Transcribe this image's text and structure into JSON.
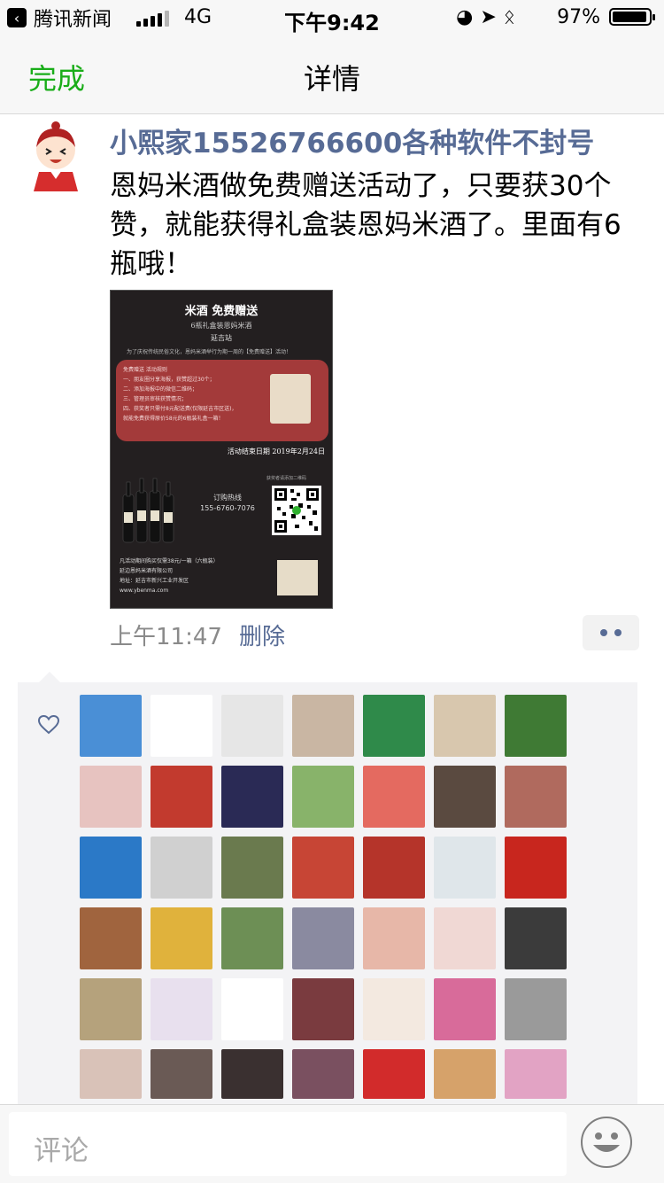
{
  "status_bar": {
    "back_app": "腾讯新闻",
    "network": "4G",
    "time": "下午9:42",
    "battery": "97%"
  },
  "nav": {
    "done": "完成",
    "title": "详情"
  },
  "post": {
    "author": "小熙家15526766600各种软件不封号",
    "text": "恩妈米酒做免费赠送活动了，只要获30个赞，就能获得礼盒装恩妈米酒了。里面有6瓶哦！",
    "time": "上午11:47",
    "delete": "删除"
  },
  "post_image": {
    "title": "米酒 免费赠送",
    "subtitle": "6瓶礼盒装恩妈米酒",
    "location": "延吉站",
    "intro": "为了庆祝传统民俗文化，恩妈米酒举行为期一周的【免费赠送】活动！",
    "rules": "免费赠送 活动规则\n一、朋友圈分享海报，获赞超过30个；\n二、添加海报中的微信二维码；\n三、管理员审核获赞情况；\n四、获奖者只需付8元配送费(仅限延吉市区送)，\n    就能免费获得原价58元的6瓶装礼盒一箱！",
    "end_date": "活动结束日期 2019年2月24日",
    "hotline_label": "订购热线",
    "hotline": "155-6760-7076",
    "qr_note": "获奖者请添加二维码",
    "footer": "凡活动期间购买仅需38元/一箱（六瓶装）\n延边恩妈米酒有限公司\n地址：延吉市新兴工业开发区\nwww.ybenma.com"
  },
  "likes": {
    "icon": "heart-outline-icon",
    "avatars": [
      {
        "name": "avatar-palm-tree",
        "color": "#4a8fd6"
      },
      {
        "name": "avatar-cartoon-girl",
        "color": "#ffffff"
      },
      {
        "name": "avatar-blank",
        "color": "#e6e6e6"
      },
      {
        "name": "avatar-child",
        "color": "#c9b6a3"
      },
      {
        "name": "avatar-pool-table",
        "color": "#2f8a4a"
      },
      {
        "name": "avatar-woman-office",
        "color": "#d8c7ae"
      },
      {
        "name": "avatar-green-wall",
        "color": "#3f7a34"
      },
      {
        "name": "avatar-two-girls",
        "color": "#e7c3c0"
      },
      {
        "name": "avatar-red-fan",
        "color": "#c23a2e"
      },
      {
        "name": "avatar-night-bridge",
        "color": "#2a2a55"
      },
      {
        "name": "avatar-baby",
        "color": "#88b36a"
      },
      {
        "name": "avatar-girl-red",
        "color": "#e46a60"
      },
      {
        "name": "avatar-couple",
        "color": "#5a4a40"
      },
      {
        "name": "avatar-selfie-pair",
        "color": "#b06a5e"
      },
      {
        "name": "avatar-fish",
        "color": "#2b79c7"
      },
      {
        "name": "avatar-bw-woman",
        "color": "#d0d0d0"
      },
      {
        "name": "avatar-mountain",
        "color": "#6a7a4e"
      },
      {
        "name": "avatar-kid-hat",
        "color": "#c74535"
      },
      {
        "name": "avatar-lion-dance",
        "color": "#b5342a"
      },
      {
        "name": "avatar-elephant",
        "color": "#dfe6ea"
      },
      {
        "name": "avatar-tata-ad",
        "color": "#c8261e"
      },
      {
        "name": "avatar-hand",
        "color": "#a0643e"
      },
      {
        "name": "avatar-poster",
        "color": "#e0b23c"
      },
      {
        "name": "avatar-bridge-man",
        "color": "#6d8f55"
      },
      {
        "name": "avatar-wedding",
        "color": "#8a8aa0"
      },
      {
        "name": "avatar-cat-filter",
        "color": "#e7b7a8"
      },
      {
        "name": "avatar-long-hair",
        "color": "#f0d8d4"
      },
      {
        "name": "avatar-dark-girl",
        "color": "#3b3b3b"
      },
      {
        "name": "avatar-sketch",
        "color": "#b5a27c"
      },
      {
        "name": "avatar-anime",
        "color": "#e8e0ee"
      },
      {
        "name": "avatar-logo",
        "color": "#ffffff"
      },
      {
        "name": "avatar-girl-hat",
        "color": "#7a3b3f"
      },
      {
        "name": "avatar-anime-girl",
        "color": "#f3e9e0"
      },
      {
        "name": "avatar-flowers",
        "color": "#d86b9a"
      },
      {
        "name": "avatar-cap-girl",
        "color": "#9a9a9a"
      },
      {
        "name": "avatar-woman-1",
        "color": "#d9c2b8"
      },
      {
        "name": "avatar-woman-2",
        "color": "#6a5a55"
      },
      {
        "name": "avatar-woman-3",
        "color": "#3a3030"
      },
      {
        "name": "avatar-woman-4",
        "color": "#7a5060"
      },
      {
        "name": "avatar-strawberries",
        "color": "#d22b2b"
      },
      {
        "name": "avatar-cat",
        "color": "#d6a26a"
      },
      {
        "name": "avatar-umbrella",
        "color": "#e2a3c4"
      }
    ]
  },
  "comment_bar": {
    "placeholder": "评论",
    "emoji_icon": "smiley-face-icon"
  }
}
